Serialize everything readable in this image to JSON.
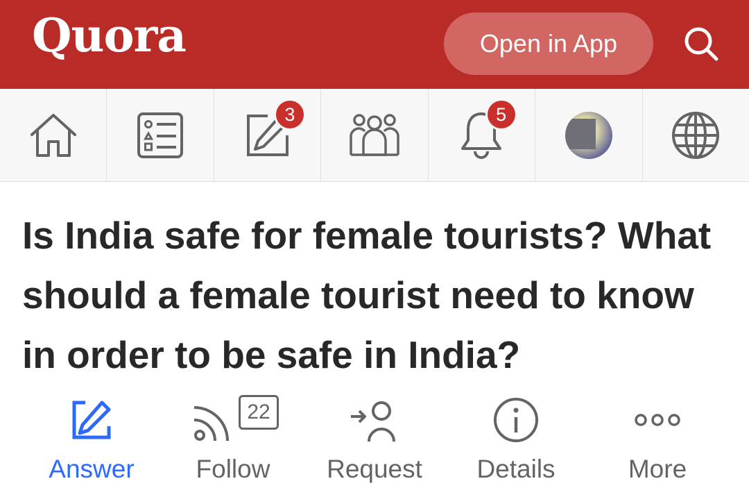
{
  "header": {
    "logo": "Quora",
    "open_in_app": "Open in App",
    "search_icon": "search-icon"
  },
  "nav": {
    "items": [
      {
        "name": "home",
        "icon": "home-icon"
      },
      {
        "name": "following",
        "icon": "feed-list-icon"
      },
      {
        "name": "answer",
        "icon": "pencil-square-icon",
        "badge": "3"
      },
      {
        "name": "spaces",
        "icon": "people-group-icon"
      },
      {
        "name": "notifications",
        "icon": "bell-icon",
        "badge": "5"
      },
      {
        "name": "profile",
        "icon": "avatar"
      },
      {
        "name": "language",
        "icon": "globe-icon"
      }
    ]
  },
  "question": {
    "title": "Is India safe for female tourists? What should a female tourist need to know in order to be safe in India?"
  },
  "actions": {
    "answer": "Answer",
    "follow": "Follow",
    "follow_count": "22",
    "request": "Request",
    "details": "Details",
    "more": "More"
  },
  "colors": {
    "brand_red": "#b92b27",
    "accent_blue": "#2e69ff",
    "text_dark": "#282829",
    "icon_gray": "#636466"
  }
}
